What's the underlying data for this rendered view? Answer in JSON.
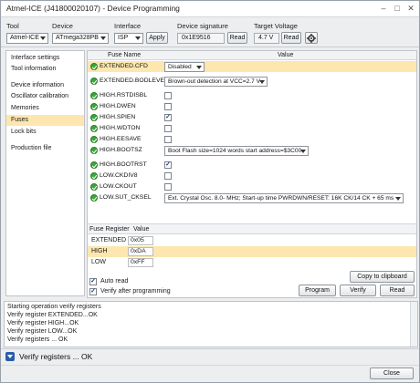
{
  "window": {
    "title": "Atmel-ICE (J41800020107) - Device Programming",
    "minimize": "–",
    "maximize": "□",
    "close": "✕"
  },
  "toolbar": {
    "tool_label": "Tool",
    "tool_value": "Atmel-ICE",
    "device_label": "Device",
    "device_value": "ATmega328PB",
    "interface_label": "Interface",
    "interface_value": "ISP",
    "apply_label": "Apply",
    "signature_label": "Device signature",
    "signature_value": "0x1E9516",
    "read_signature_label": "Read",
    "voltage_label": "Target Voltage",
    "voltage_value": "4.7 V",
    "read_voltage_label": "Read",
    "settings_icon": "gear-icon"
  },
  "sidebar": {
    "items": [
      {
        "label": "Interface settings"
      },
      {
        "label": "Tool information"
      },
      {
        "label": "Device information"
      },
      {
        "label": "Oscillator calibration"
      },
      {
        "label": "Memories"
      },
      {
        "label": "Fuses"
      },
      {
        "label": "Lock bits"
      },
      {
        "label": "Production file"
      }
    ],
    "selected": "Fuses"
  },
  "fuses": {
    "col_name": "Fuse Name",
    "col_value": "Value",
    "rows": [
      {
        "name": "EXTENDED.CFD",
        "kind": "combo",
        "value": "Disabled"
      },
      {
        "name": "EXTENDED.BODLEVEL",
        "kind": "combo",
        "value": "Brown-out detection at VCC=2.7 V"
      },
      {
        "name": "HIGH.RSTDISBL",
        "kind": "check",
        "checked": false
      },
      {
        "name": "HIGH.DWEN",
        "kind": "check",
        "checked": false
      },
      {
        "name": "HIGH.SPIEN",
        "kind": "check",
        "checked": true
      },
      {
        "name": "HIGH.WDTON",
        "kind": "check",
        "checked": false
      },
      {
        "name": "HIGH.EESAVE",
        "kind": "check",
        "checked": false
      },
      {
        "name": "HIGH.BOOTSZ",
        "kind": "combo",
        "value": "Boot Flash size=1024 words start address=$3C00"
      },
      {
        "name": "HIGH.BOOTRST",
        "kind": "check",
        "checked": true
      },
      {
        "name": "LOW.CKDIV8",
        "kind": "check",
        "checked": false
      },
      {
        "name": "LOW.CKOUT",
        "kind": "check",
        "checked": false
      },
      {
        "name": "LOW.SUT_CKSEL",
        "kind": "combo",
        "value": "Ext. Crystal Osc. 8.0-    MHz; Start-up time PWRDWN/RESET: 16K CK/14 CK + 65 ms"
      }
    ]
  },
  "registers": {
    "col_register": "Fuse Register",
    "col_value": "Value",
    "rows": [
      {
        "name": "EXTENDED",
        "value": "0x05"
      },
      {
        "name": "HIGH",
        "value": "0xDA"
      },
      {
        "name": "LOW",
        "value": "0xFF"
      }
    ],
    "selected": "HIGH"
  },
  "options": {
    "auto_read_label": "Auto read",
    "auto_read_checked": true,
    "verify_label": "Verify after programming",
    "verify_checked": true
  },
  "actions": {
    "copy_label": "Copy to clipboard",
    "program_label": "Program",
    "verify_label": "Verify",
    "read_label": "Read"
  },
  "log": {
    "lines": [
      "Starting operation verify registers",
      "Verify register EXTENDED...OK",
      "Verify register HIGH...OK",
      "Verify register LOW...OK",
      "Verify registers ... OK"
    ]
  },
  "status": {
    "text": "Verify registers ... OK"
  },
  "footer": {
    "close_label": "Close"
  }
}
